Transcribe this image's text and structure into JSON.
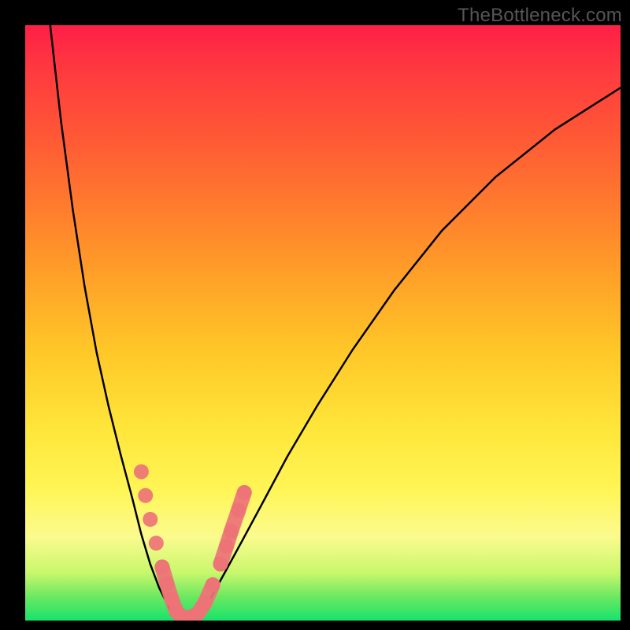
{
  "watermark": "TheBottleneck.com",
  "colors": {
    "frame": "#000000",
    "curve": "#000000",
    "marker": "#ed7377",
    "gradient_top": "#ff1f47",
    "gradient_bottom": "#17e36c"
  },
  "chart_data": {
    "type": "line",
    "title": "",
    "xlabel": "",
    "ylabel": "",
    "xlim": [
      0,
      100
    ],
    "ylim": [
      0,
      100
    ],
    "note": "Bottleneck-style V-curve. x is a normalized hardware-balance axis (0–100), y is bottleneck percentage (0 = no bottleneck at valley floor, 100 = severe at top). Values estimated from pixel positions; no axis ticks are shown in the source image.",
    "series": [
      {
        "name": "left-branch",
        "x": [
          4.2,
          6.0,
          8.0,
          10.0,
          12.0,
          14.0,
          16.0,
          18.0,
          19.5,
          21.0,
          22.5,
          24.0,
          25.0
        ],
        "y": [
          100.0,
          84.0,
          69.0,
          56.0,
          45.0,
          36.0,
          28.0,
          20.5,
          14.5,
          9.5,
          5.5,
          2.5,
          0.5
        ]
      },
      {
        "name": "valley",
        "x": [
          25.0,
          26.0,
          27.0,
          28.0,
          29.0
        ],
        "y": [
          0.5,
          0.0,
          0.0,
          0.0,
          0.5
        ]
      },
      {
        "name": "right-branch",
        "x": [
          29.0,
          31.0,
          33.5,
          36.5,
          40.0,
          44.0,
          49.0,
          55.0,
          62.0,
          70.0,
          79.0,
          89.0,
          100.0
        ],
        "y": [
          0.5,
          3.5,
          8.0,
          13.5,
          20.0,
          27.5,
          36.0,
          45.5,
          55.5,
          65.5,
          74.5,
          82.5,
          89.5
        ]
      }
    ],
    "markers": {
      "name": "highlighted-points",
      "note": "Pink bead markers clustered near the valley on both branches.",
      "points": [
        {
          "x": 19.5,
          "y": 25.0
        },
        {
          "x": 20.2,
          "y": 21.0
        },
        {
          "x": 21.0,
          "y": 17.0
        },
        {
          "x": 22.0,
          "y": 13.0
        },
        {
          "x": 23.0,
          "y": 9.0
        },
        {
          "x": 23.8,
          "y": 6.2
        },
        {
          "x": 24.6,
          "y": 3.6
        },
        {
          "x": 25.4,
          "y": 1.5
        },
        {
          "x": 26.5,
          "y": 0.5
        },
        {
          "x": 27.8,
          "y": 0.5
        },
        {
          "x": 29.0,
          "y": 1.2
        },
        {
          "x": 30.2,
          "y": 3.0
        },
        {
          "x": 31.5,
          "y": 6.0
        },
        {
          "x": 32.8,
          "y": 9.5
        },
        {
          "x": 33.8,
          "y": 12.5
        },
        {
          "x": 34.6,
          "y": 15.0
        },
        {
          "x": 35.8,
          "y": 18.5
        },
        {
          "x": 36.8,
          "y": 21.5
        }
      ]
    }
  }
}
